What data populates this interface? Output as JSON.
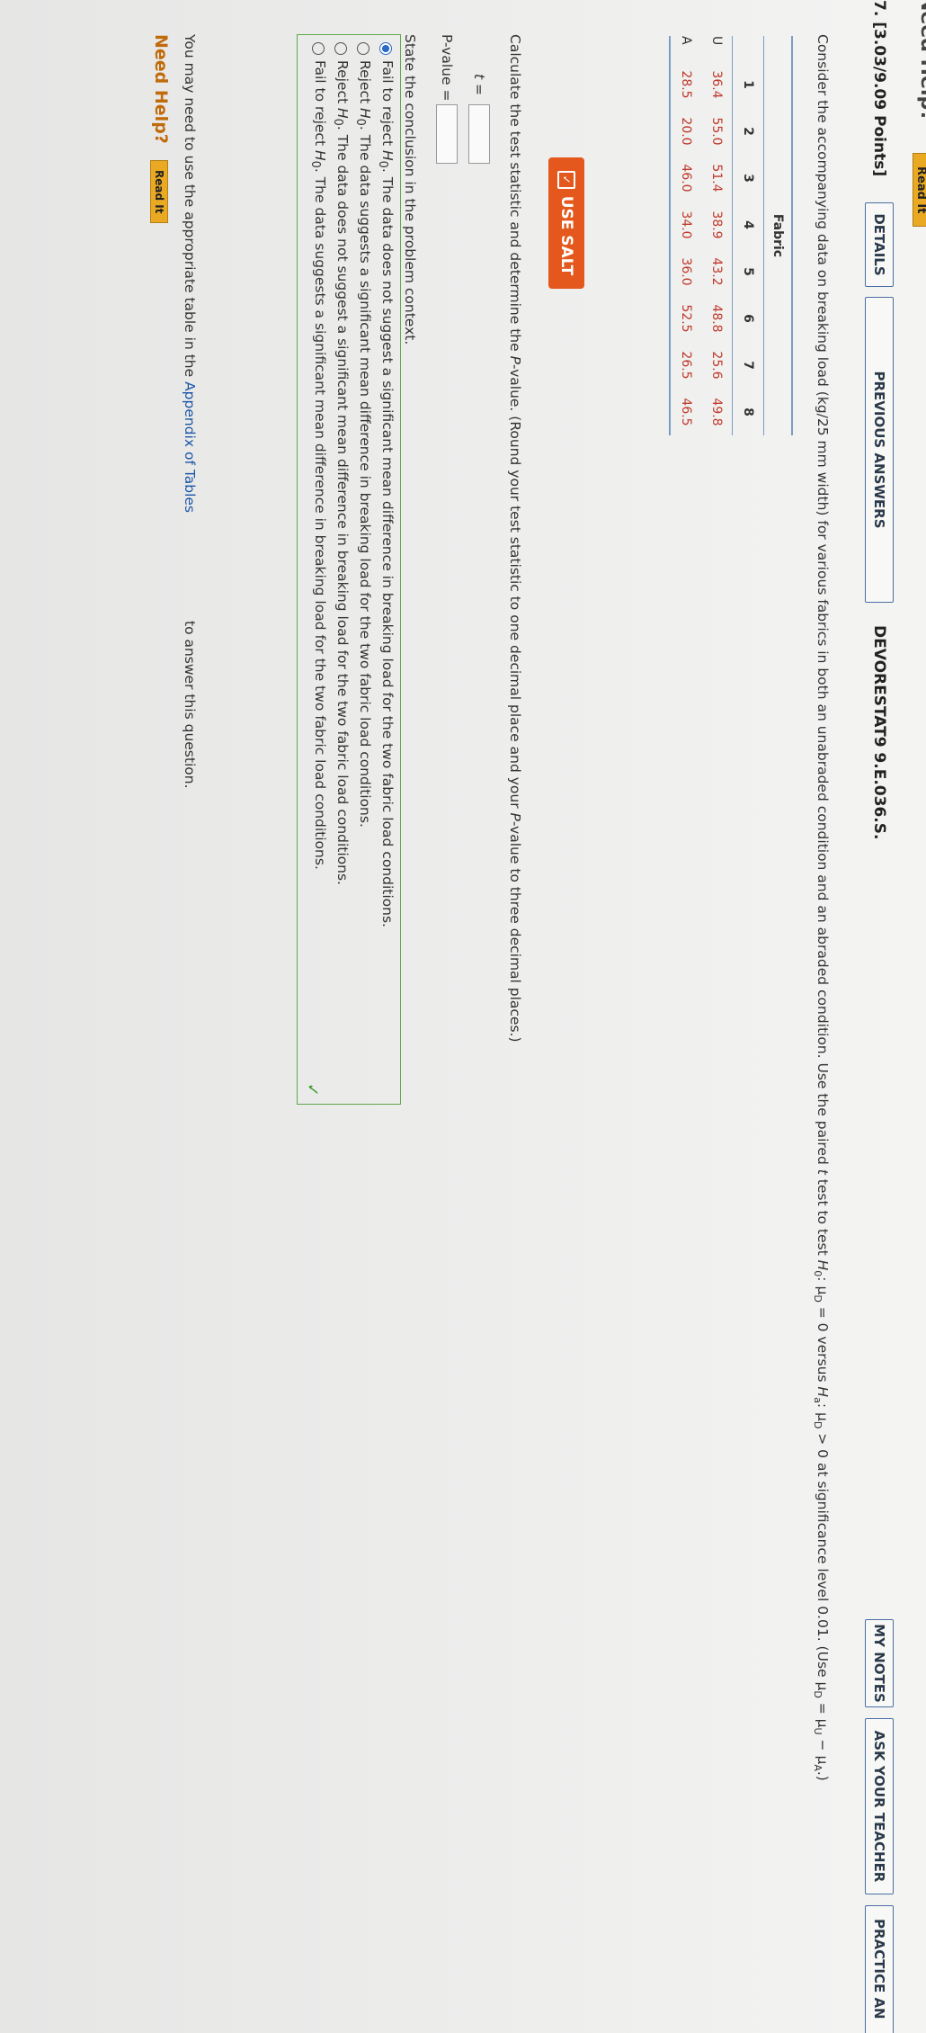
{
  "header": {
    "top_need_help": "Need Help?",
    "top_read_it": "Read It",
    "question_number": "7.",
    "points": "[3.03/9.09 Points]",
    "details_label": "DETAILS",
    "previous_answers_label": "PREVIOUS ANSWERS",
    "assignment_code": "DEVORESTAT9 9.E.036.S.",
    "my_notes_label": "MY NOTES",
    "ask_teacher_label": "ASK YOUR TEACHER",
    "practice_label": "PRACTICE AN"
  },
  "prompt": {
    "text_a": "Consider the accompanying data on breaking load (kg/25 mm width) for various fabrics in both an unabraded condition and an abraded condition. Use the paired ",
    "t": "t",
    "text_b": " test to test ",
    "h0": "H",
    "h0_sub": "0",
    "h0_rest": ": μ",
    "h0_D": "D",
    "h0_eq": " = 0 versus ",
    "ha": "H",
    "ha_sub": "a",
    "ha_rest": ": μ",
    "ha_D": "D",
    "ha_eq": " > 0 at significance level 0.01. (Use μ",
    "use_D": "D",
    "use_mid": " = μ",
    "use_U": "U",
    "use_minus": " − μ",
    "use_A": "A",
    "use_end": ".)"
  },
  "table": {
    "caption": "Fabric",
    "columns": [
      "",
      "1",
      "2",
      "3",
      "4",
      "5",
      "6",
      "7",
      "8"
    ],
    "rows": [
      {
        "label": "U",
        "values": [
          "36.4",
          "55.0",
          "51.4",
          "38.9",
          "43.2",
          "48.8",
          "25.6",
          "49.8"
        ]
      },
      {
        "label": "A",
        "values": [
          "28.5",
          "20.0",
          "46.0",
          "34.0",
          "36.0",
          "52.5",
          "26.5",
          "46.5"
        ]
      }
    ]
  },
  "salt": {
    "label": "USE SALT"
  },
  "calc": {
    "text_a": "Calculate the test statistic and determine the ",
    "p": "P",
    "text_b": "-value. (Round your test statistic to one decimal place and your ",
    "p2": "P",
    "text_c": "-value to three decimal places.)",
    "t_label": "t =",
    "p_label": "P-value ="
  },
  "conclusion": {
    "heading": "State the conclusion in the problem context.",
    "options": [
      {
        "pre": "Fail to reject ",
        "h": "H",
        "sub": "0",
        "post": ". The data does not suggest a significant mean difference in breaking load for the two fabric load conditions.",
        "selected": true
      },
      {
        "pre": "Reject ",
        "h": "H",
        "sub": "0",
        "post": ". The data suggests a significant mean difference in breaking load for the two fabric load conditions.",
        "selected": false
      },
      {
        "pre": "Reject ",
        "h": "H",
        "sub": "0",
        "post": ". The data does not suggest a significant mean difference in breaking load for the two fabric load conditions.",
        "selected": false
      },
      {
        "pre": "Fail to reject ",
        "h": "H",
        "sub": "0",
        "post": ". The data suggests a significant mean difference in breaking load for the two fabric load conditions.",
        "selected": false
      }
    ]
  },
  "footer": {
    "text_a": "You may need to use the appropriate table in the ",
    "link": "Appendix of Tables",
    "text_b": "to answer this question.",
    "need_help": "Need Help?",
    "read_it": "Read It"
  },
  "colors": {
    "accent": "#e4581d",
    "link": "#1c57a8",
    "correct": "#3c9a2b",
    "data_red": "#c0392b"
  }
}
